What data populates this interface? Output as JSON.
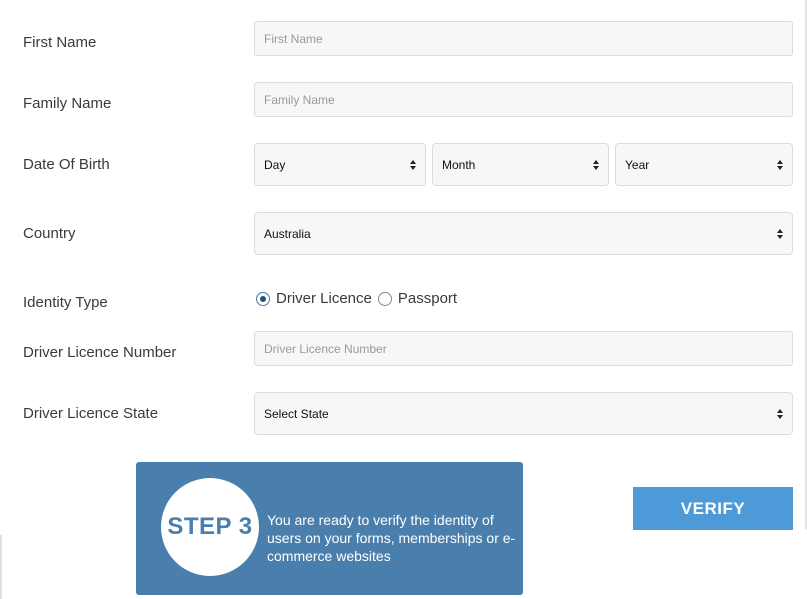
{
  "form": {
    "first_name": {
      "label": "First Name",
      "placeholder": "First Name",
      "value": ""
    },
    "family_name": {
      "label": "Family Name",
      "placeholder": "Family Name",
      "value": ""
    },
    "date_of_birth": {
      "label": "Date Of Birth",
      "day": "Day",
      "month": "Month",
      "year": "Year"
    },
    "country": {
      "label": "Country",
      "value": "Australia"
    },
    "identity_type": {
      "label": "Identity Type",
      "options": [
        {
          "label": "Driver Licence",
          "checked": true
        },
        {
          "label": "Passport",
          "checked": false
        }
      ]
    },
    "licence_number": {
      "label": "Driver Licence Number",
      "placeholder": "Driver Licence Number",
      "value": ""
    },
    "licence_state": {
      "label": "Driver Licence State",
      "value": "Select State"
    }
  },
  "step": {
    "title": "STEP 3",
    "text": "You are ready to verify the identity of users on your forms, memberships or e-commerce websites"
  },
  "verify_button": {
    "label": "VERIFY"
  },
  "colors": {
    "step_background": "#4a7fad",
    "verify_button": "#4e9ad9",
    "field_background": "#f7f7f7"
  }
}
